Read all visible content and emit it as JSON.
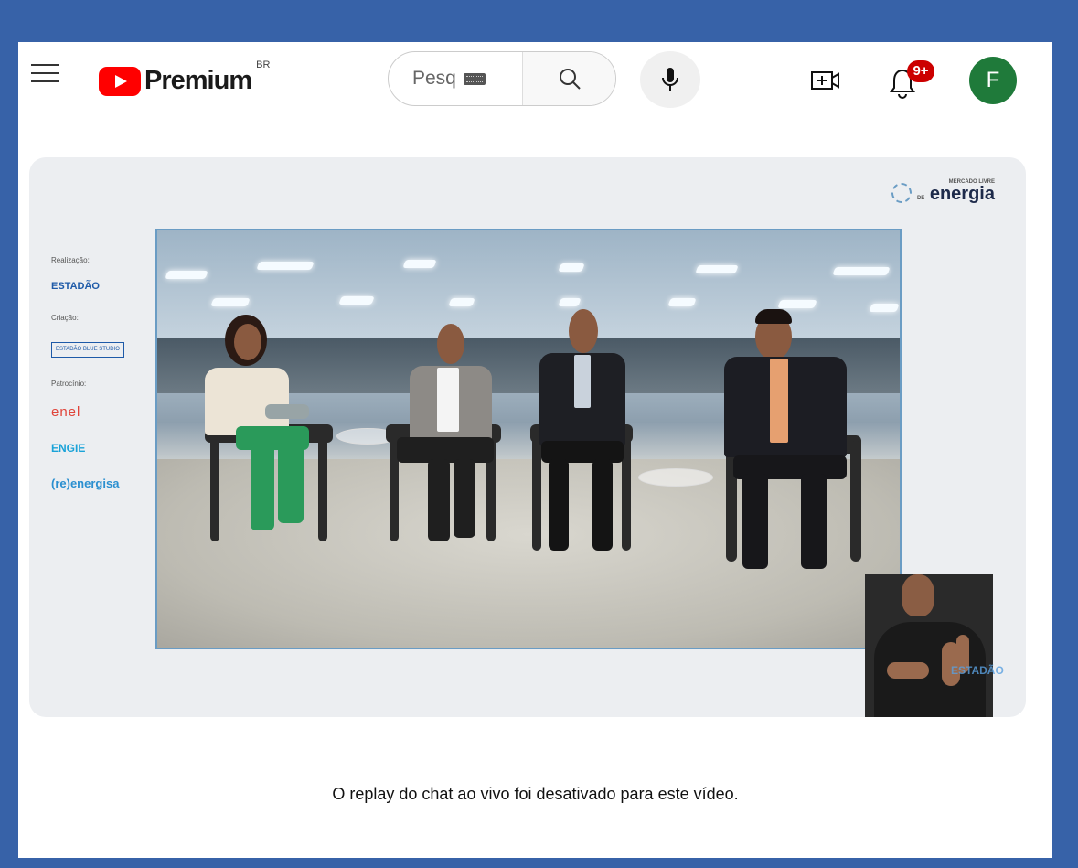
{
  "header": {
    "logo_text": "Premium",
    "logo_region": "BR",
    "search_placeholder": "Pesq",
    "notification_count": "9+",
    "avatar_letter": "F"
  },
  "player": {
    "event_logo_small": "MERCADO LIVRE",
    "event_logo_de": "DE",
    "event_logo_big": "energia",
    "sponsors": {
      "realizacao_label": "Realização:",
      "realizacao_logo": "ESTADÃO",
      "criacao_label": "Criação:",
      "criacao_logo": "ESTADÃO BLUE STUDIO",
      "patrocinio_label": "Patrocínio:",
      "logos": [
        "enel",
        "ENGIE",
        "(re)energisa"
      ]
    },
    "watermark": "ESTADÃO"
  },
  "chat": {
    "message": "O replay do chat ao vivo foi desativado para este vídeo."
  },
  "colors": {
    "frame": "#3762a8",
    "brand_red": "#ff0000",
    "avatar": "#1f7a3a",
    "badge": "#cc0000"
  },
  "icons": [
    "menu-icon",
    "youtube-logo-icon",
    "keyboard-icon",
    "search-icon",
    "microphone-icon",
    "create-video-icon",
    "bell-icon"
  ]
}
